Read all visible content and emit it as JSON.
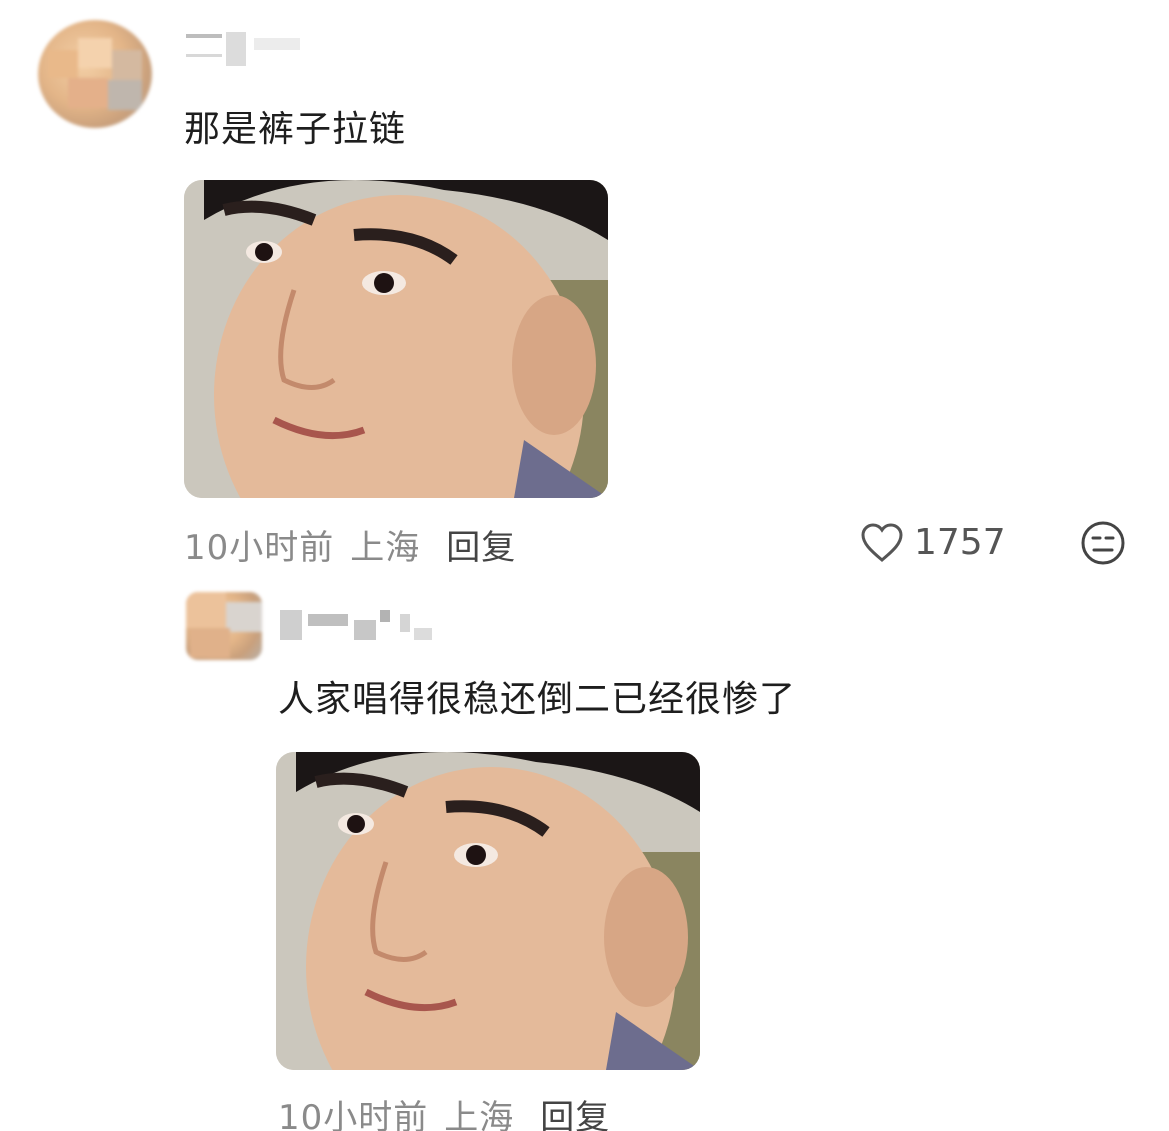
{
  "comments": [
    {
      "text": "那是裤子拉链",
      "time": "10小时前",
      "location": "上海",
      "reply_label": "回复",
      "likes": "1757",
      "like_icon": "heart-icon",
      "reaction_icon": "expressionless-face-icon"
    },
    {
      "text": "人家唱得很稳还倒二已经很惨了",
      "time": "10小时前",
      "location": "上海",
      "reply_label": "回复"
    }
  ],
  "colors": {
    "text": "#1e1e1e",
    "meta": "#8a8a8a",
    "reply": "#444444",
    "background": "#ffffff"
  }
}
